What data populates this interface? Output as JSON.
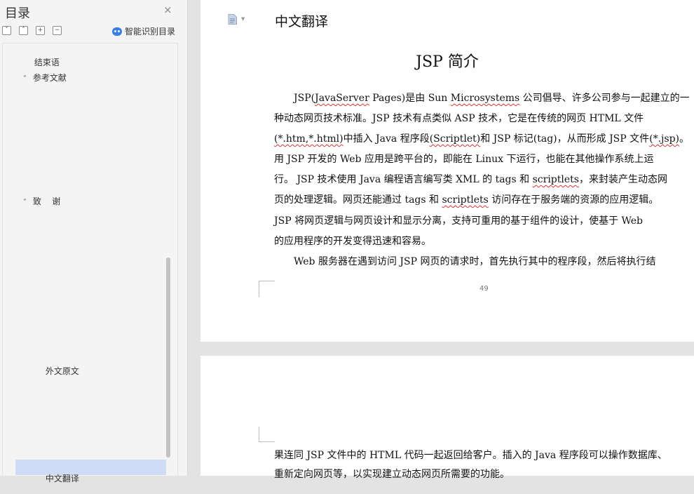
{
  "sidebar": {
    "title": "目录",
    "close_glyph": "×",
    "toolbar": {
      "collapse_glyph": "˅",
      "expand_glyph": "˄",
      "add_glyph": "+",
      "remove_glyph": "−",
      "smart_toc_label": "智能识别目录"
    },
    "items": [
      {
        "label": "结束语",
        "chevron": ""
      },
      {
        "label": "参考文献",
        "chevron": "˅"
      },
      {
        "label": "致    谢",
        "chevron": "˅"
      },
      {
        "label": "外文原文",
        "chevron": ""
      },
      {
        "label": "中文翻译",
        "chevron": "",
        "selected": true
      }
    ]
  },
  "document": {
    "page1": {
      "header": "中文翻译",
      "title": "JSP 简介",
      "page_number": "49"
    },
    "page2": {}
  },
  "icons": [
    "document-icon",
    "dropdown-arrow-icon",
    "close-icon",
    "collapse-all-icon",
    "expand-all-icon",
    "add-heading-icon",
    "remove-heading-icon",
    "ai-assistant-icon"
  ],
  "colors": {
    "selection": "#cfdcf5",
    "accent": "#3a7ee6",
    "spell_error": "#d33"
  }
}
